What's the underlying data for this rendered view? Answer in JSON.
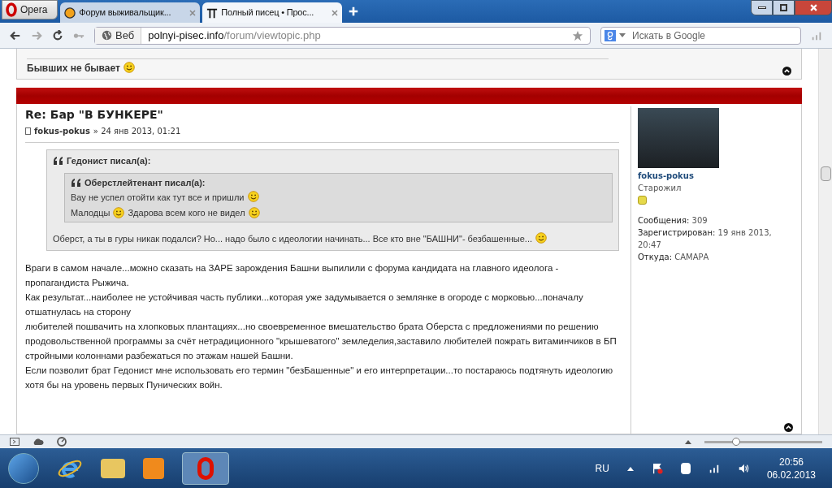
{
  "browser": {
    "menu_label": "Opera",
    "tabs": [
      {
        "title": "Форум выживальщик...",
        "selected": false
      },
      {
        "title": "Полный писец • Прос...",
        "selected": true
      }
    ],
    "address": {
      "badge": "Веб",
      "host": "polnyi-pisec.info",
      "path": "/forum/viewtopic.php"
    },
    "search": {
      "placeholder": "Искать в Google"
    }
  },
  "previous_post": {
    "signature": "Бывших не бывает"
  },
  "post": {
    "title": "Re: Бар \"В БУНКЕРЕ\"",
    "author": "fokus-pokus",
    "date": "» 24 янв 2013, 01:21",
    "quote": {
      "header": "Гедонист писал(а):",
      "inner": {
        "header": "Оберстлейтенант писал(а):",
        "lines": [
          "Вау не успел отойти как тут все и пришли",
          "Малодцы",
          "Здарова всем кого не видел"
        ]
      },
      "text": "Оберст, а ты в гуры никак подалси? Но... надо было с идеологии начинать... Все кто вне \"БАШНИ\"- безбашенные..."
    },
    "body": [
      "Враги в самом начале...можно сказать на ЗАРЕ зарождения Башни выпилили с форума кандидата на главного идеолога - пропагандиста Рыжича.",
      "Как результат...наиболее не устойчивая часть публики...которая уже задумывается о землянке в огороде с морковью...поначалу отшатнулась на сторону",
      "любителей пошвачить на хлопковых плантациях...но своевременное вмешательство брата Оберста с предложениями по решению продовольственной программы за счёт нетрадиционного \"крышеватого\" земледелия,заставило любителей пожрать витаминчиков в БП стройными колоннами разбежаться по этажам нашей Башни.",
      "Если позволит брат Гедонист мне использовать его термин \"безБашенные\" и его интерпретации...то постараюсь подтянуть идеологию хотя бы на уровень первых Пунических войн."
    ],
    "profile": {
      "name": "fokus-pokus",
      "rank": "Старожил",
      "stats": [
        {
          "label": "Сообщения:",
          "value": "309"
        },
        {
          "label": "Зарегистрирован:",
          "value": "19 янв 2013, 20:47"
        },
        {
          "label": "Откуда:",
          "value": "САМАРА"
        }
      ]
    }
  },
  "status_bar": {
    "zoom": {
      "level": 0.27
    }
  },
  "taskbar": {
    "language": "RU",
    "time": "20:56",
    "date": "06.02.2013"
  }
}
